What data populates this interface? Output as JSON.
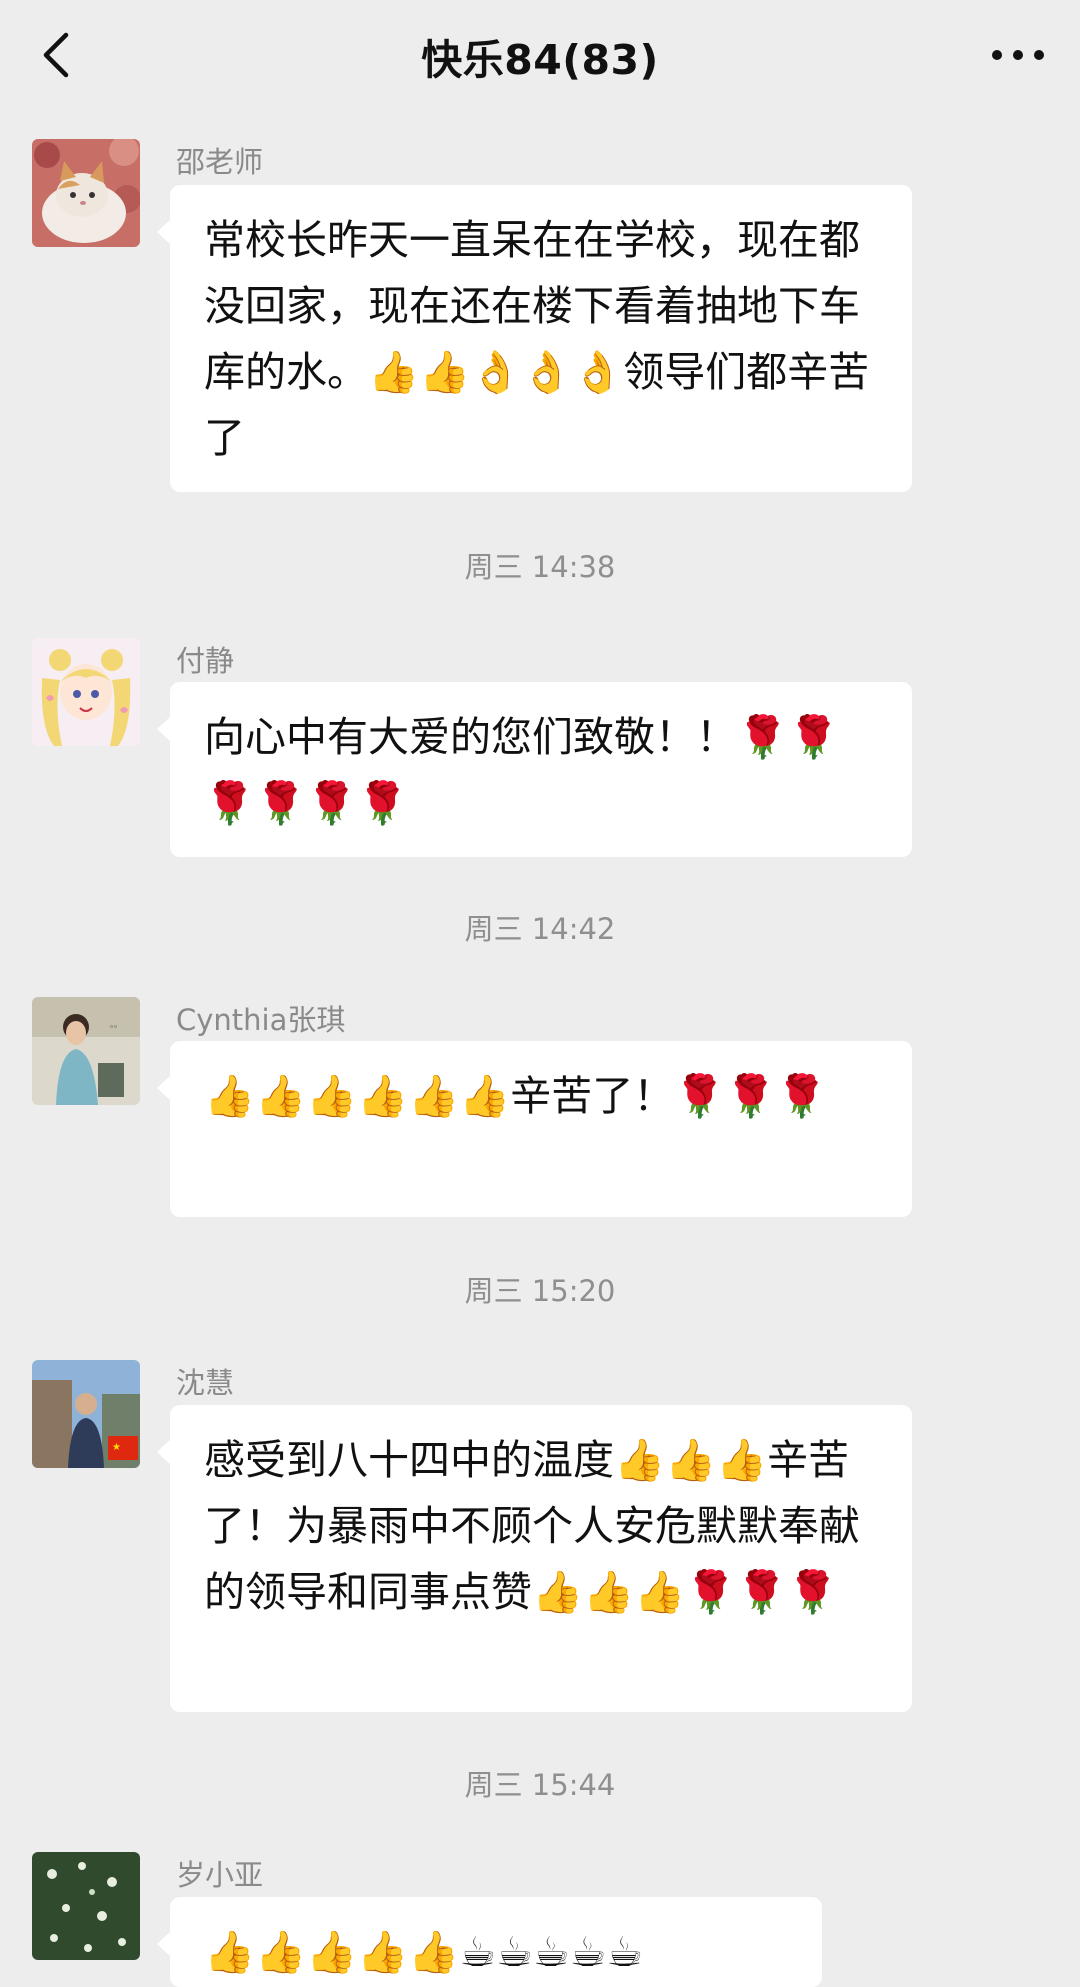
{
  "header": {
    "title": "快乐84(83)",
    "back_icon": "chevron-left-icon",
    "more_icon": "more-horizontal-icon"
  },
  "messages": [
    {
      "sender": "邵老师",
      "text": "常校长昨天一直呆在在学校，现在都没回家，现在还在楼下看着抽地下车库的水。👍👍👌👌👌领导们都辛苦了"
    },
    {
      "sender": "付静",
      "text": "向心中有大爱的您们致敬！！🌹🌹🌹🌹🌹🌹"
    },
    {
      "sender": "Cynthia张琪",
      "text": "👍👍👍👍👍👍辛苦了！🌹🌹🌹"
    },
    {
      "sender": "沈慧",
      "text": "感受到八十四中的温度👍👍👍辛苦了！为暴雨中不顾个人安危默默奉献的领导和同事点赞👍👍👍🌹🌹🌹"
    },
    {
      "sender": "岁小亚",
      "text": "👍👍👍👍👍☕☕☕☕☕"
    }
  ],
  "timestamps": [
    "周三 14:38",
    "周三 14:42",
    "周三 15:20",
    "周三 15:44"
  ]
}
